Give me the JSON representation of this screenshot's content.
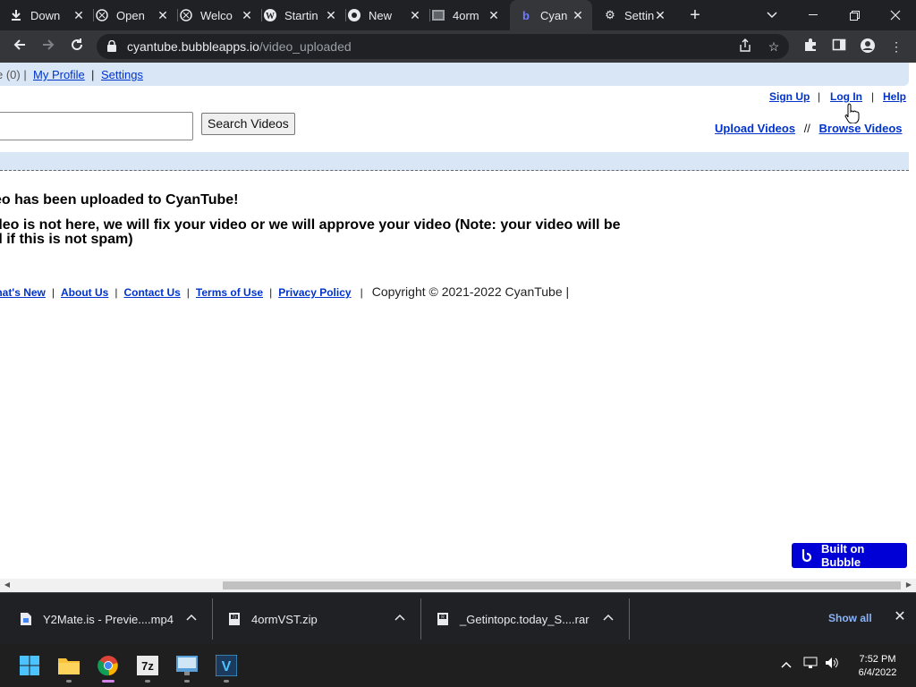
{
  "browser": {
    "tabs": [
      {
        "label": "Down",
        "icon": "download-icon"
      },
      {
        "label": "Open",
        "icon": "openai-icon"
      },
      {
        "label": "Welco",
        "icon": "openai-icon"
      },
      {
        "label": "Startin",
        "icon": "wordpress-icon"
      },
      {
        "label": "New",
        "icon": "chrome-icon"
      },
      {
        "label": "4orm",
        "icon": "site-icon"
      },
      {
        "label": "Cyan",
        "icon": "bubble-icon"
      },
      {
        "label": "Settin",
        "icon": "gear-icon"
      }
    ],
    "url_host": "cyantube.bubbleapps.io",
    "url_path": "/video_uploaded"
  },
  "page": {
    "topbar": {
      "count_text": "e (0) |",
      "my_profile": "My Profile",
      "settings": "Settings",
      "sep": "|"
    },
    "toplinks": {
      "sign_up": "Sign Up",
      "log_in": "Log In",
      "help": "Help",
      "sep": "|"
    },
    "search": {
      "button": "Search Videos",
      "value": ""
    },
    "nav": {
      "upload": "Upload Videos",
      "sep": "//",
      "browse": "Browse Videos"
    },
    "message": {
      "line1": "eo has been uploaded to CyanTube!",
      "line2": "deo is not here, we will fix your video or we will approve your video (Note: your video will be",
      "line3": "d if this is not spam)"
    },
    "footer": {
      "whats_new": "/hat's New",
      "about_us": "About Us",
      "contact_us": "Contact Us",
      "terms": "Terms of Use",
      "privacy": "Privacy Policy",
      "sep": "|",
      "copyright": "Copyright © 2021-2022 CyanTube |"
    },
    "badge": "Built on Bubble"
  },
  "downloads": {
    "items": [
      {
        "name": "Y2Mate.is - Previe....mp4"
      },
      {
        "name": "4ormVST.zip"
      },
      {
        "name": "_Getintopc.today_S....rar"
      }
    ],
    "show_all": "Show all"
  },
  "taskbar": {
    "time": "7:52 PM",
    "date": "6/4/2022"
  },
  "colors": {
    "link": "#0033cc",
    "blue_bar": "#d9e6f5",
    "bubble_badge": "#0000d6",
    "chrome_dark": "#202124",
    "chrome_toolbar": "#35363a"
  }
}
